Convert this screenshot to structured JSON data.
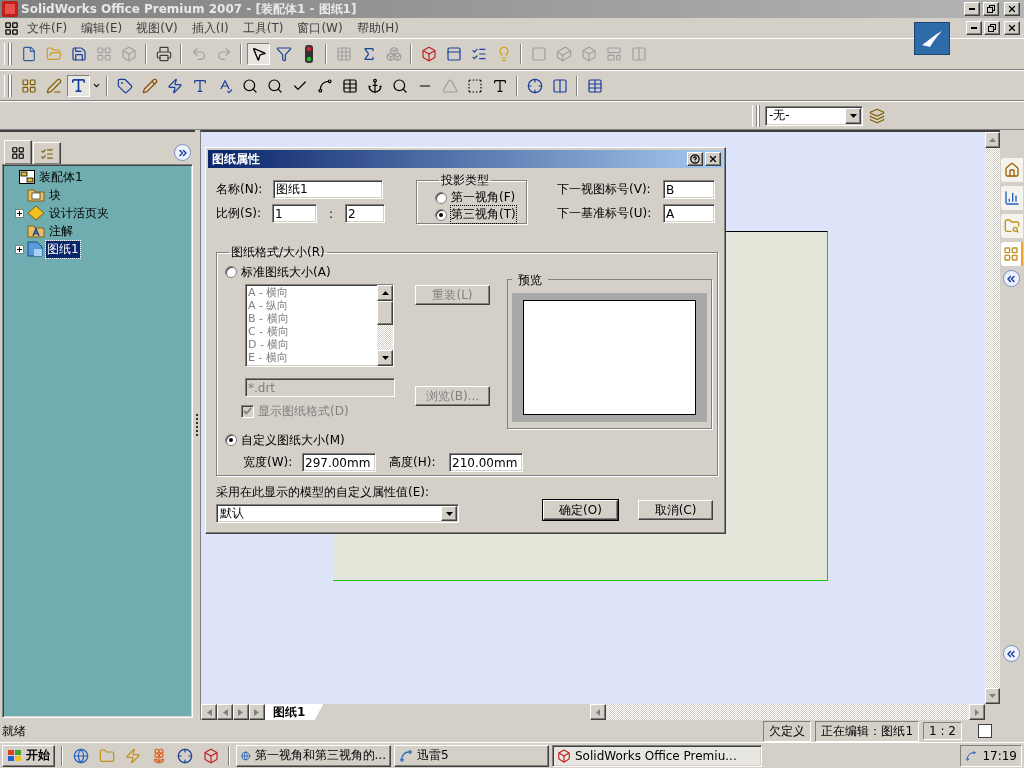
{
  "window": {
    "title": "SolidWorks Office Premium 2007 - [装配体1 - 图纸1]"
  },
  "menu": [
    {
      "label": "文件(F)"
    },
    {
      "label": "编辑(E)"
    },
    {
      "label": "视图(V)"
    },
    {
      "label": "插入(I)"
    },
    {
      "label": "工具(T)"
    },
    {
      "label": "窗口(W)"
    },
    {
      "label": "帮助(H)"
    }
  ],
  "layer_dropdown": {
    "value": "-无-"
  },
  "feature_tree": {
    "items": [
      {
        "label": "装配体1",
        "kind": "assembly",
        "selected": false,
        "children": [
          {
            "label": "块",
            "kind": "block",
            "selected": false
          },
          {
            "label": "设计活页夹",
            "kind": "binder",
            "selected": false,
            "expanded": false
          },
          {
            "label": "注解",
            "kind": "annotation",
            "selected": false
          },
          {
            "label": "图纸1",
            "kind": "sheet",
            "selected": true,
            "expanded": false
          }
        ]
      }
    ]
  },
  "dialog": {
    "title": "图纸属性",
    "name": {
      "label": "名称(N):",
      "value": "图纸1"
    },
    "scale": {
      "label": "比例(S):",
      "numerator": "1",
      "separator": ":",
      "denominator": "2"
    },
    "projection": {
      "title": "投影类型",
      "options": [
        {
          "label": "第一视角(F)",
          "selected": false
        },
        {
          "label": "第三视角(T)",
          "selected": true
        }
      ]
    },
    "next_view": {
      "label": "下一视图标号(V):",
      "value": "B"
    },
    "next_datum": {
      "label": "下一基准标号(U):",
      "value": "A"
    },
    "sheet_format": {
      "title": "图纸格式/大小(R)",
      "size_options": [
        {
          "label": "标准图纸大小(A)",
          "selected": false
        },
        {
          "label": "自定义图纸大小(M)",
          "selected": true
        }
      ],
      "sizes": {
        "disabled": true,
        "items": [
          "A - 横向",
          "A - 纵向",
          "B - 横向",
          "C - 横向",
          "D - 横向",
          "E - 横向"
        ]
      },
      "reload_button": {
        "label": "重装(L)",
        "disabled": true
      },
      "template": {
        "value": "*.drt",
        "disabled": true
      },
      "browse_button": {
        "label": "浏览(B)...",
        "disabled": true
      },
      "show_format": {
        "label": "显示图纸格式(D)",
        "checked": true,
        "disabled": true
      },
      "preview": {
        "title": "预览"
      },
      "width": {
        "label": "宽度(W):",
        "value": "297.00mm"
      },
      "height": {
        "label": "高度(H):",
        "value": "210.00mm"
      }
    },
    "property": {
      "label": "采用在此显示的模型的自定义属性值(E):",
      "value": "默认"
    },
    "buttons": [
      {
        "label": "确定(O)",
        "default": true
      },
      {
        "label": "取消(C)",
        "default": false
      }
    ]
  },
  "task_pane": {
    "tabs": [
      {
        "selected": false
      },
      {
        "selected": false
      },
      {
        "selected": false
      },
      {
        "selected": true
      }
    ]
  },
  "sheet_tabs": [
    {
      "label": "图纸1",
      "selected": true
    }
  ],
  "status_bar": {
    "message": "就绪",
    "state": "欠定义",
    "editing": "正在编辑：图纸1",
    "scale": "1 : 2"
  },
  "taskbar": {
    "start": "开始",
    "tasks": [
      {
        "label": "第一视角和第三视角的...",
        "selected": false
      },
      {
        "label": "迅雷5",
        "selected": false
      },
      {
        "label": "SolidWorks Office Premiu...",
        "selected": true
      }
    ],
    "clock": "17:19"
  }
}
